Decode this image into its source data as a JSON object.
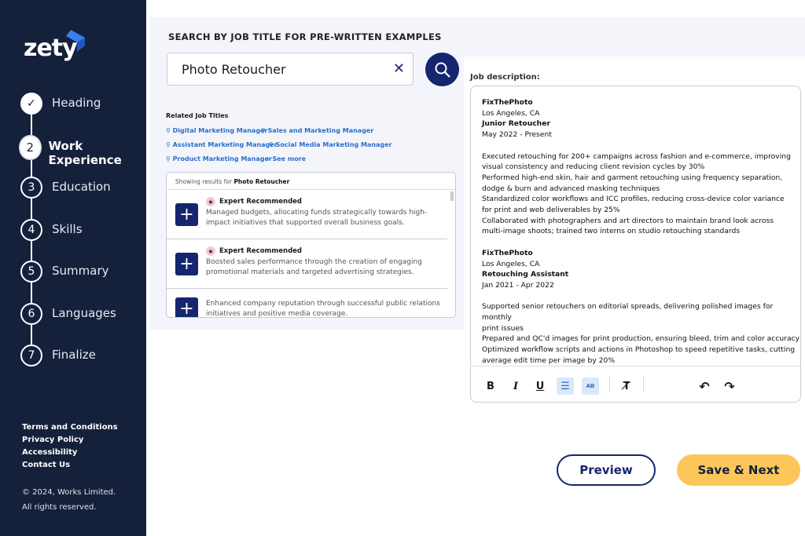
{
  "brand": {
    "name": "zety"
  },
  "steps": [
    {
      "num": "✓",
      "label": "Heading"
    },
    {
      "num": "2",
      "label": "Work Experience"
    },
    {
      "num": "3",
      "label": "Education"
    },
    {
      "num": "4",
      "label": "Skills"
    },
    {
      "num": "5",
      "label": "Summary"
    },
    {
      "num": "6",
      "label": "Languages"
    },
    {
      "num": "7",
      "label": "Finalize"
    }
  ],
  "footer": {
    "links": [
      "Terms and Conditions",
      "Privacy Policy",
      "Accessibility",
      "Contact Us"
    ],
    "copyright": "© 2024, Works Limited.",
    "rights": "All rights reserved."
  },
  "search": {
    "title": "SEARCH BY JOB TITLE FOR PRE-WRITTEN EXAMPLES",
    "value": "Photo Retoucher",
    "clear": "✕"
  },
  "related": {
    "heading": "Related Job Titles",
    "items": [
      "Digital Marketing Manager",
      "Sales and Marketing Manager",
      "Assistant Marketing Manager",
      "Social Media Marketing Manager",
      "Product Marketing Manager"
    ],
    "see_more": "+ See more"
  },
  "results": {
    "prefix": "Showing results for",
    "query": "Photo Retoucher",
    "badge": "Expert Recommended",
    "items": [
      "Managed budgets, allocating funds strategically towards high-impact initiatives that supported overall business goals.",
      "Boosted sales performance through the creation of engaging promotional materials and targeted advertising strategies.",
      "Enhanced company reputation through successful public relations initiatives and positive media coverage."
    ]
  },
  "job": {
    "label": "Job description:",
    "lines": [
      {
        "t": "FixThePhoto",
        "b": true
      },
      {
        "t": "Los Angeles, CA"
      },
      {
        "t": "Junior Retoucher",
        "b": true
      },
      {
        "t": "May 2022 - Present"
      },
      {
        "t": ""
      },
      {
        "t": "Executed retouching for 200+ campaigns across fashion and e-commerce, improving"
      },
      {
        "t": "visual consistency and reducing client revision cycles by 30%"
      },
      {
        "t": "Performed high-end skin, hair and garment retouching using frequency separation,"
      },
      {
        "t": "dodge & burn and advanced masking techniques"
      },
      {
        "t": "Standardized color workflows and ICC profiles, reducing cross-device color variance"
      },
      {
        "t": "for print and web deliverables by 25%"
      },
      {
        "t": "Collaborated with photographers and art directors to maintain brand look across"
      },
      {
        "t": "multi-image shoots; trained two interns on studio retouching standards"
      },
      {
        "t": ""
      },
      {
        "t": "FixThePhoto",
        "b": true
      },
      {
        "t": "Los Angeles, CA"
      },
      {
        "t": "Retouching Assistant",
        "b": true
      },
      {
        "t": "Jan 2021 - Apr 2022"
      },
      {
        "t": ""
      },
      {
        "t": "Supported senior retouchers on editorial spreads, delivering polished images for monthly"
      },
      {
        "t": "print issues"
      },
      {
        "t": "Prepared and QC'd images for print production, ensuring bleed, trim and color accuracy"
      },
      {
        "t": "Optimized workflow scripts and actions in Photoshop to speed repetitive tasks, cutting"
      },
      {
        "t": "average edit time per image by 20%"
      }
    ]
  },
  "toolbar": {
    "bold": "B",
    "italic": "I",
    "underline": "U",
    "list": "☰",
    "spell": "AB",
    "clear": "T̸",
    "undo": "↶",
    "redo": "↷"
  },
  "actions": {
    "preview": "Preview",
    "next": "Save & Next"
  }
}
